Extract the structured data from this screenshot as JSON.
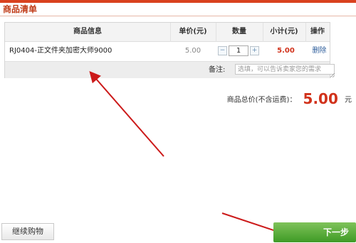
{
  "section": {
    "title": "商品清单"
  },
  "table": {
    "headers": {
      "product_info": "商品信息",
      "unit_price": "单价(元)",
      "quantity": "数量",
      "subtotal": "小计(元)",
      "action": "操作"
    },
    "rows": [
      {
        "product_name": "RJ0404-正文件夹加密大师9000",
        "unit_price": "5.00",
        "quantity": "1",
        "subtotal": "5.00",
        "action": "删除"
      }
    ],
    "remark": {
      "label": "备注:",
      "placeholder": "选填，可以告诉卖家您的需求"
    }
  },
  "summary": {
    "label": "商品总价(不含运费)：",
    "amount": "5.00",
    "unit": "元"
  },
  "footer": {
    "continue_label": "继续购物",
    "next_label": "下一步"
  },
  "qty_controls": {
    "minus": "−",
    "plus": "+"
  },
  "icons": {
    "minus": "minus-icon",
    "plus": "plus-icon",
    "resize": "resize-grip-icon",
    "watermark": "baidu-watermark-icon"
  },
  "colors": {
    "accent": "#d9421f",
    "price_red": "#d1321b",
    "link_blue": "#2c5c9a",
    "next_green": "#3e9a25",
    "annotation_red": "#cc1a1a"
  }
}
